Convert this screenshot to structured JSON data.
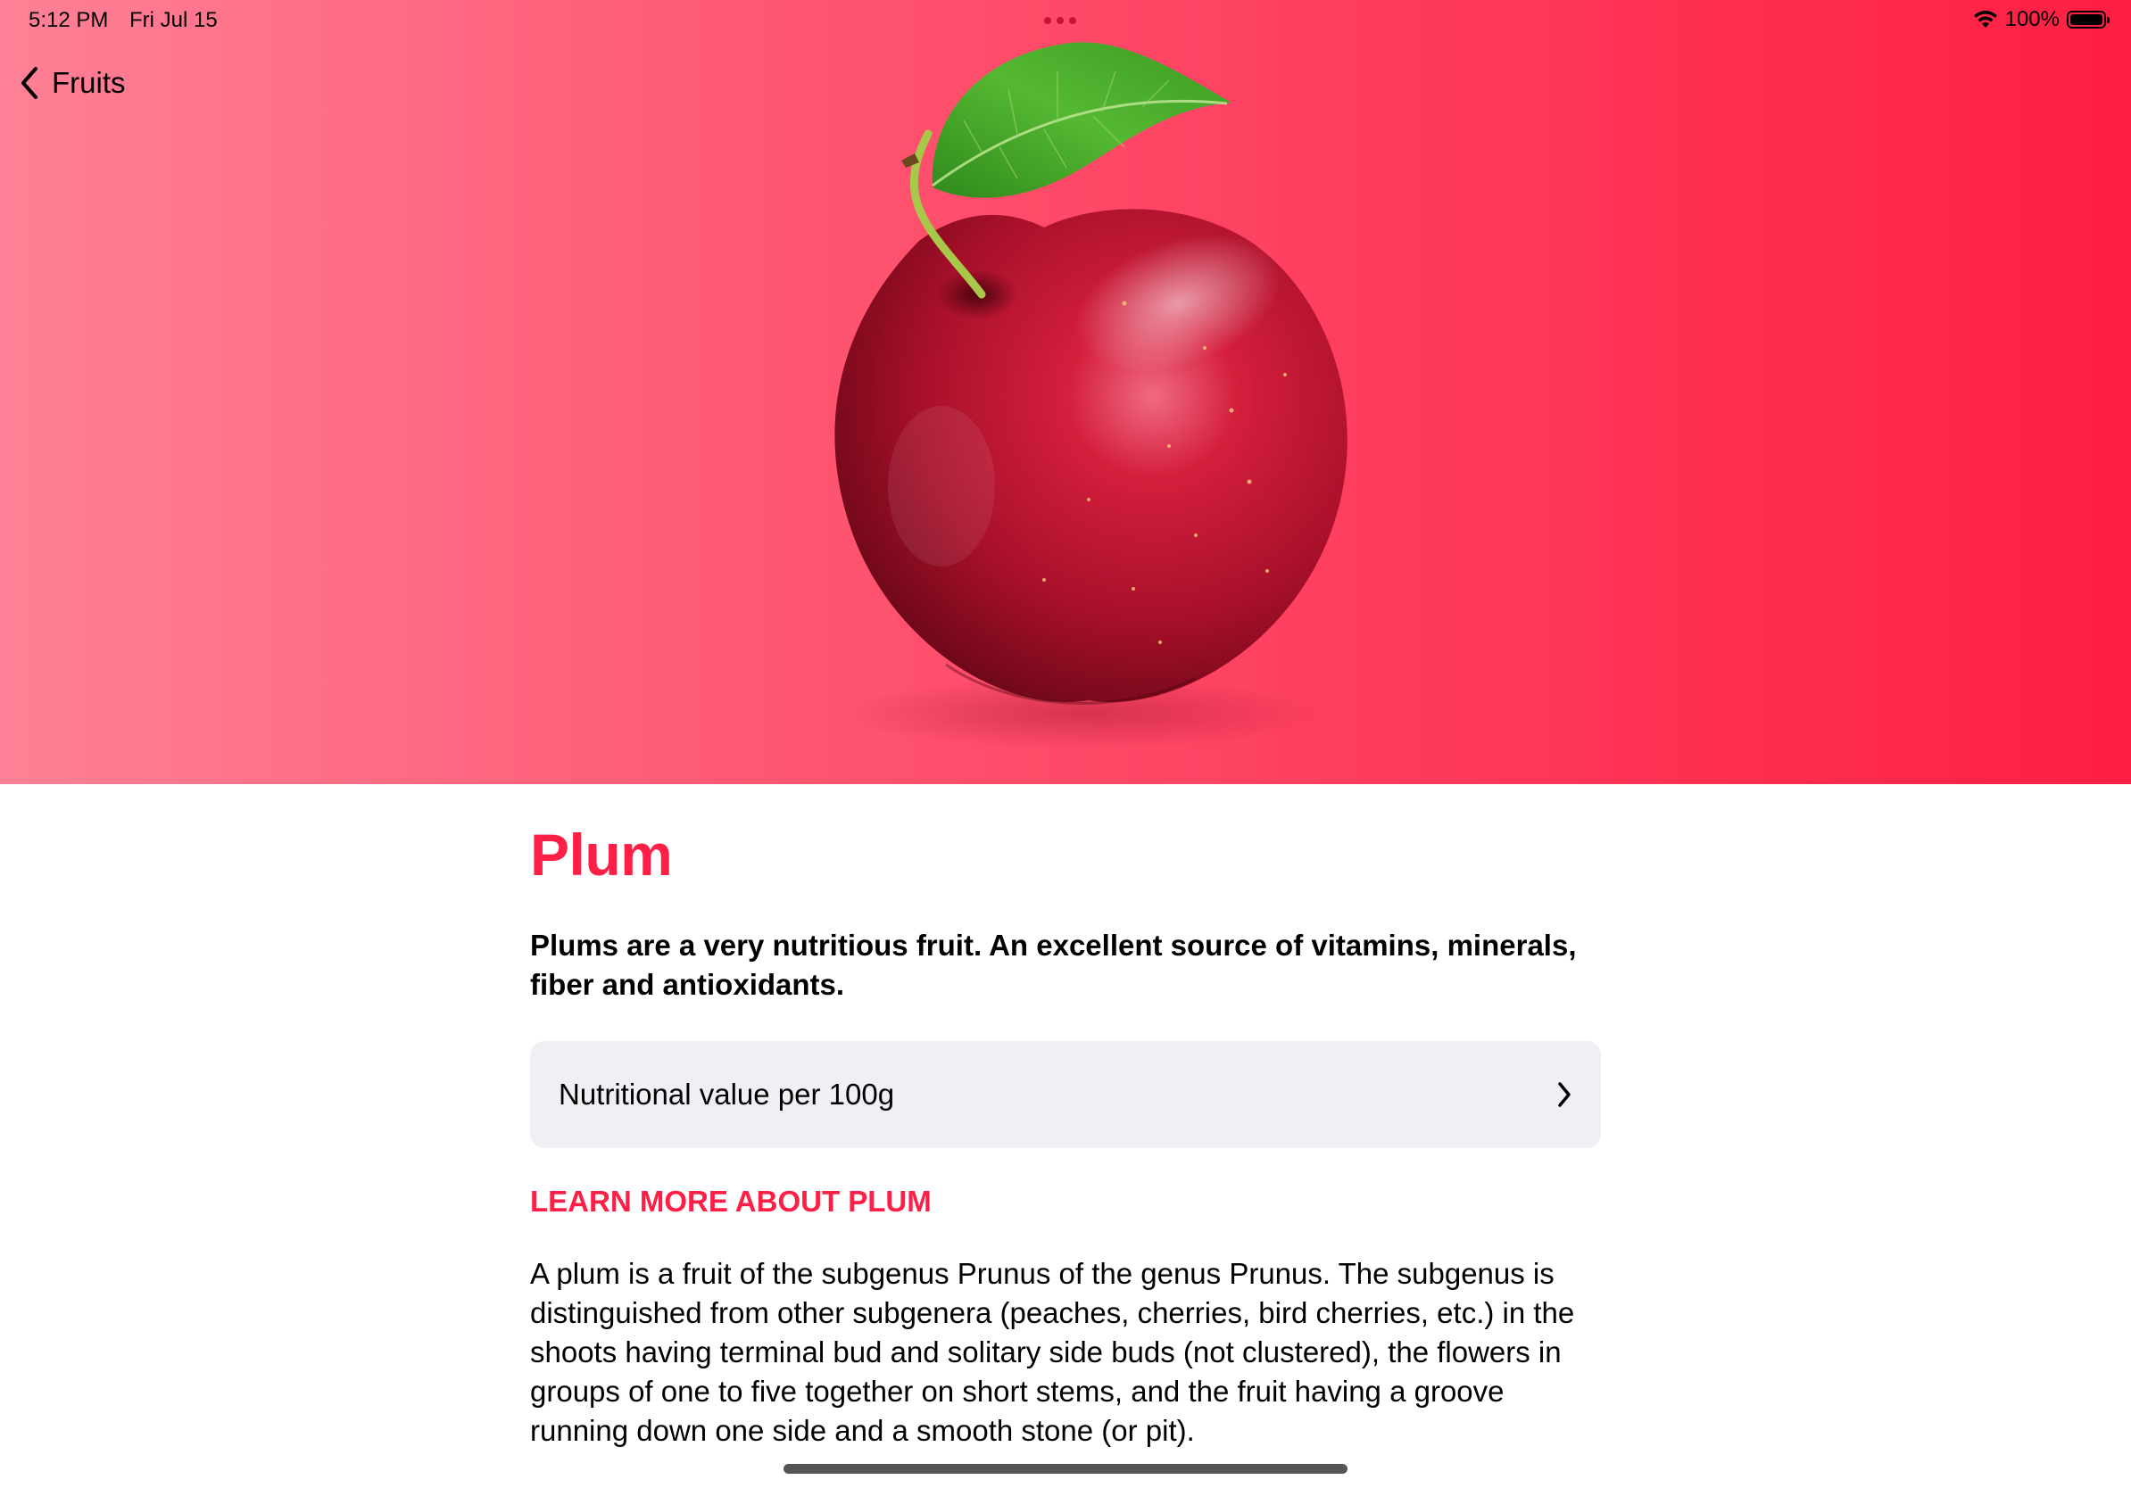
{
  "status_bar": {
    "time": "5:12 PM",
    "date": "Fri Jul 15",
    "battery_percent": "100%",
    "battery_level": 1.0
  },
  "nav": {
    "back_label": "Fruits"
  },
  "hero": {
    "gradient_colors": [
      "#fe8196",
      "#fe1f42"
    ],
    "image_icon": "plum-image"
  },
  "fruit": {
    "title": "Plum",
    "summary": "Plums are a very nutritious fruit. An excellent source of vitamins, minerals, fiber and antioxidants.",
    "nutrition_label": "Nutritional value per 100g",
    "learn_more_heading": "LEARN MORE ABOUT PLUM",
    "description": "A plum is a fruit of the subgenus Prunus of the genus Prunus. The subgenus is distinguished from other subgenera (peaches, cherries, bird cherries, etc.) in the shoots having terminal bud and solitary side buds (not clustered), the flowers in groups of one to five together on short stems, and the fruit having a groove running down one side and a smooth stone (or pit)."
  },
  "colors": {
    "accent": "#fe1f47",
    "row_background": "#efeff4"
  }
}
